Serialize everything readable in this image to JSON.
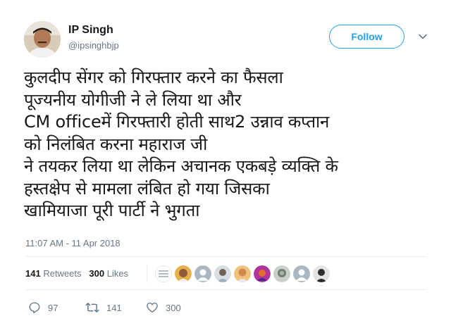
{
  "user": {
    "name": "IP Singh",
    "handle": "@ipsinghbjp",
    "avatar_icon": "profile-photo-avatar"
  },
  "follow_button": {
    "label": "Follow",
    "color": "#1da1f2"
  },
  "menu": {
    "icon": "chevron-down-icon"
  },
  "tweet": {
    "lines": [
      "कुलदीप सेंगर को गिरफ्तार करने का फैसला",
      "पूज्यनीय योगीजी ने ले लिया था और",
      "CM officeमें गिरफ्तारी होती साथ2 उन्नाव कप्तान",
      "को निलंबित करना महाराज जी",
      "ने तयकर लिया था लेकिन अचानक एकबड़े व्यक्ति के",
      "हस्तक्षेप से मामला लंबित हो गया जिसका",
      "खामियाजा पूरी पार्टी ने भुगता"
    ]
  },
  "timestamp": "11:07 AM - 11 Apr 2018",
  "stats": {
    "retweets_count": "141",
    "retweets_label": "Retweets",
    "likes_count": "300",
    "likes_label": "Likes"
  },
  "likers": [
    {
      "icon": "liker-avatar-1",
      "color": "#b9c4c9"
    },
    {
      "icon": "liker-avatar-2",
      "color": "#8f5a3c"
    },
    {
      "icon": "liker-avatar-3",
      "color": "#aab8c2"
    },
    {
      "icon": "liker-avatar-4",
      "color": "#9ab0bd"
    },
    {
      "icon": "liker-avatar-5",
      "color": "#d18a4e"
    },
    {
      "icon": "liker-avatar-6",
      "color": "#b0339e"
    },
    {
      "icon": "liker-avatar-7",
      "color": "#6f7d73"
    },
    {
      "icon": "liker-avatar-8",
      "color": "#aab8c2"
    },
    {
      "icon": "liker-avatar-9",
      "color": "#2d2d2d"
    }
  ],
  "actions": {
    "reply_count": "97",
    "retweet_count": "141",
    "like_count": "300"
  }
}
